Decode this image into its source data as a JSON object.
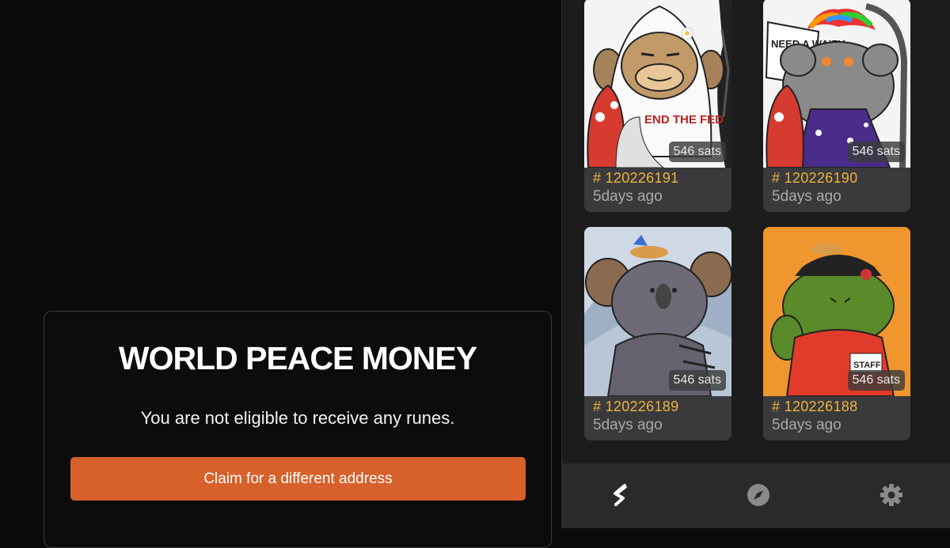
{
  "claim": {
    "title": "WORLD PEACE MONEY",
    "message": "You are not eligible to receive any runes.",
    "button_label": "Claim for a different address"
  },
  "inscriptions": [
    {
      "number": "# 120226191",
      "age": "5days ago",
      "price": "546 sats",
      "art": "white-hooded-monkey"
    },
    {
      "number": "# 120226190",
      "age": "5days ago",
      "price": "546 sats",
      "art": "rainbow-hair-koala"
    },
    {
      "number": "# 120226189",
      "age": "5days ago",
      "price": "546 sats",
      "art": "koala-mountains"
    },
    {
      "number": "# 120226188",
      "age": "5days ago",
      "price": "546 sats",
      "art": "green-frog-staff"
    }
  ],
  "art_text": {
    "card1_shirt": "END THE FED",
    "card2_sign": "NEED A WAIFU",
    "card4_shirt": "STAFF"
  },
  "nav": {
    "items": [
      {
        "icon": "runes-logo-icon",
        "active": true
      },
      {
        "icon": "compass-icon",
        "active": false
      },
      {
        "icon": "gear-icon",
        "active": false
      }
    ]
  },
  "colors": {
    "accent": "#d8602a",
    "inscription_number": "#f0b33c",
    "background": "#0b0a0a",
    "panel": "#1c1c1d"
  }
}
